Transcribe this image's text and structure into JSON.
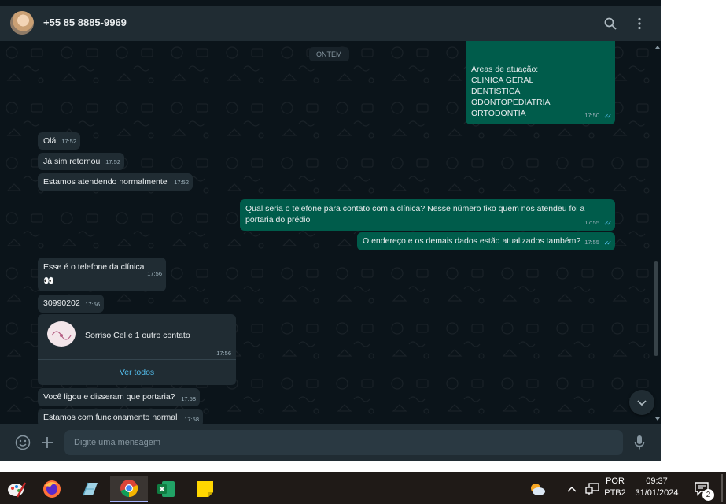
{
  "header": {
    "contact_name": "+55 85 8885-9969",
    "icons": [
      "search-icon",
      "menu-dots-icon"
    ]
  },
  "chat": {
    "date_divider": "ONTEM",
    "messages": [
      {
        "direction": "out",
        "lines": [
          "Áreas de atuação:",
          "CLINICA GERAL",
          "DENTISTICA",
          "ODONTOPEDIATRIA",
          "ORTODONTIA"
        ],
        "time": "17:50"
      },
      {
        "direction": "in",
        "text": "Olá",
        "time": "17:52"
      },
      {
        "direction": "in",
        "text": "Já sim retornou",
        "time": "17:52"
      },
      {
        "direction": "in",
        "text": "Estamos atendendo normalmente",
        "time": "17:52"
      },
      {
        "direction": "out",
        "lines": [
          "Qual seria o telefone para contato com a clínica? Nesse número fixo quem nos atendeu foi a",
          "portaria do prédio"
        ],
        "time": "17:55"
      },
      {
        "direction": "out",
        "text": "O endereço e os demais dados estão atualizados também?",
        "time": "17:55"
      },
      {
        "direction": "in",
        "text": "Esse é o telefone da clínica",
        "emoji": "👀",
        "time": "17:56"
      },
      {
        "direction": "in",
        "text": "30990202",
        "time": "17:56"
      },
      {
        "direction": "in",
        "type": "contact-card",
        "title": "Sorriso Cel e 1 outro contato",
        "time": "17:56",
        "action": "Ver todos"
      },
      {
        "direction": "in",
        "text": "Você ligou e disseram que portaria?",
        "time": "17:58"
      },
      {
        "direction": "in",
        "text": "Estamos com funcionamento normal",
        "time": "17:58"
      }
    ]
  },
  "composer": {
    "placeholder": "Digite uma mensagem",
    "icons": [
      "emoji-icon",
      "plus-icon",
      "microphone-icon"
    ]
  },
  "taskbar": {
    "apps": [
      "paint-icon",
      "firefox-icon",
      "notepad-icon",
      "chrome-icon",
      "excel-icon",
      "sticky-notes-icon"
    ],
    "active_app": "chrome-icon",
    "language_line1": "POR",
    "language_line2": "PTB2",
    "time": "09:37",
    "date": "31/01/2024",
    "notification_count": "2"
  },
  "colors": {
    "header_bg": "#202c33",
    "chat_bg": "#0b141a",
    "incoming_bubble": "#202c33",
    "outgoing_bubble": "#005c4b",
    "read_ticks": "#53bdeb",
    "link": "#53bdeb"
  }
}
